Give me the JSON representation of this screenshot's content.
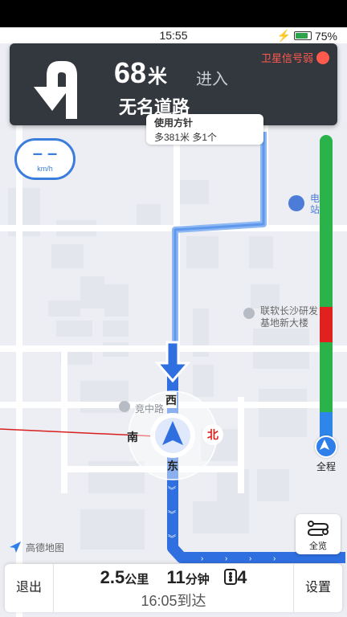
{
  "status_bar": {
    "time": "15:55",
    "battery": "75%"
  },
  "guidance": {
    "distance": "68",
    "distance_unit": "米",
    "action": "进入",
    "road": "无名道路",
    "gps_warning": "卫星信号弱"
  },
  "speed": {
    "value": "– –",
    "unit": "km/h"
  },
  "route_tip": {
    "line1": "使用方针",
    "line2": "多381米 多1个"
  },
  "compass": {
    "north": "北",
    "south": "南",
    "east": "东",
    "west": "西"
  },
  "map_labels": {
    "poi1": "竞中路",
    "poi2_line1": "联软长沙研发",
    "poi2_line2": "基地新大楼",
    "charge": "电 站"
  },
  "full_route_label": "全程",
  "overview_label": "全览",
  "logo_text": "高德地图",
  "bottom": {
    "exit": "退出",
    "settings": "设置",
    "distance": "2.5",
    "distance_unit": "公里",
    "minutes": "11",
    "minutes_unit": "分钟",
    "lights": "4",
    "arrival": "16:05到达"
  },
  "colors": {
    "route": "#2f6fe0",
    "traffic_green": "#2ab34a",
    "traffic_red": "#e0211d",
    "panel": "#33373e"
  }
}
